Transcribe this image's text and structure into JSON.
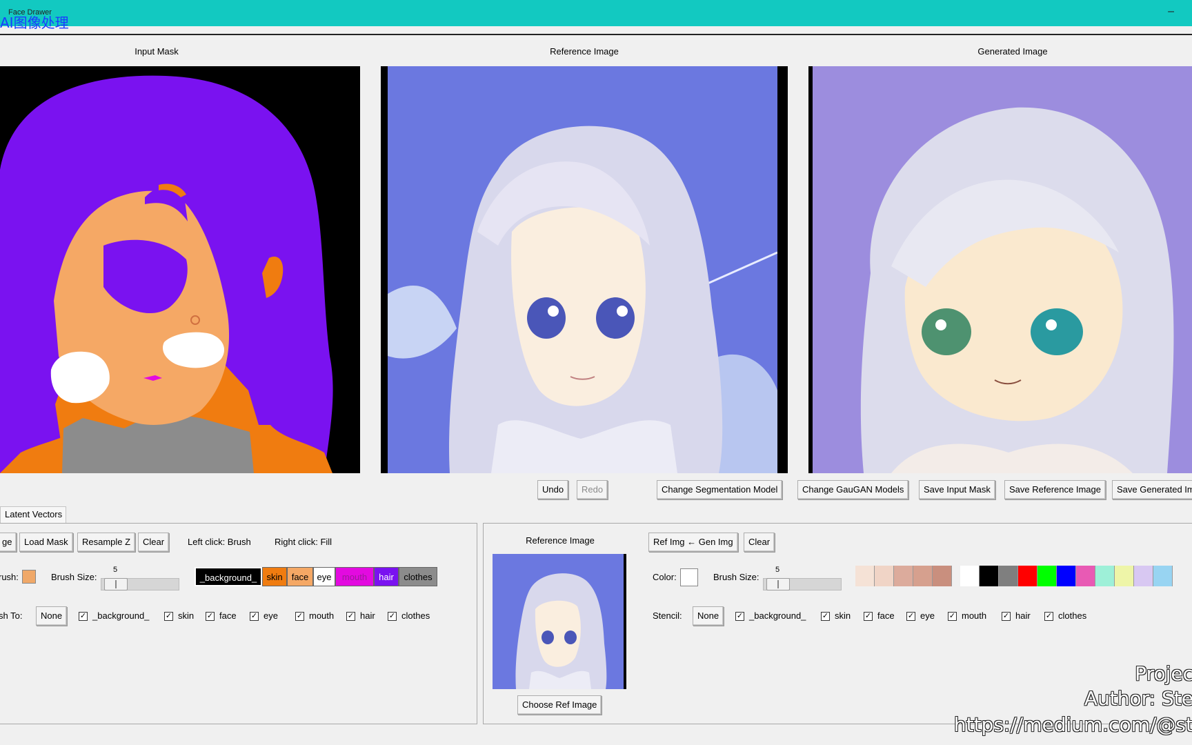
{
  "window": {
    "title": "Face Drawer",
    "overlay_title": "AI图像处理",
    "minimize_glyph": "–"
  },
  "panels": {
    "input_mask": {
      "title": "Input Mask"
    },
    "reference_image": {
      "title": "Reference Image"
    },
    "generated_image": {
      "title": "Generated Image"
    }
  },
  "toolbar": {
    "undo": "Undo",
    "redo": "Redo",
    "change_segmentation_model": "Change Segmentation Model",
    "change_gaugan_models": "Change GauGAN Models",
    "save_input_mask": "Save Input Mask",
    "save_reference_image": "Save Reference Image",
    "save_generated_image": "Save Generated Im"
  },
  "tabs": {
    "latent_vectors": "Latent Vectors"
  },
  "mask_controls": {
    "load_image": "ge",
    "load_mask": "Load Mask",
    "resample_z": "Resample Z",
    "clear": "Clear",
    "left_click_hint": "Left click: Brush",
    "right_click_hint": "Right click: Fill",
    "brush_label": "rush:",
    "brush_color": "#f0a868",
    "brush_size_label": "Brush Size:",
    "brush_size_value": "5",
    "brush_size_fraction": 0.05,
    "segments": [
      {
        "label": "_background_",
        "bg": "#000000",
        "fg": "#ffffff"
      },
      {
        "label": "skin",
        "bg": "#f07c10",
        "fg": "#000000"
      },
      {
        "label": "face",
        "bg": "#f5a865",
        "fg": "#000000"
      },
      {
        "label": "eye",
        "bg": "#ffffff",
        "fg": "#000000"
      },
      {
        "label": "mouth",
        "bg": "#e30ae0",
        "fg": "#9a1a9a"
      },
      {
        "label": "hair",
        "bg": "#7a12f0",
        "fg": "#ffffff"
      },
      {
        "label": "clothes",
        "bg": "#8c8c8c",
        "fg": "#000000"
      }
    ],
    "brush_to_label": "sh To:",
    "none_button": "None",
    "checkboxes": [
      "_background_",
      "skin",
      "face",
      "eye",
      "mouth",
      "hair",
      "clothes"
    ]
  },
  "ref_controls": {
    "title": "Reference Image",
    "choose_ref": "Choose Ref Image",
    "ref_from_gen": "Ref Img ← Gen Img",
    "clear": "Clear",
    "color_label": "Color:",
    "color_value": "#ffffff",
    "brush_size_label": "Brush Size:",
    "brush_size_value": "5",
    "brush_size_fraction": 0.05,
    "stencil_label": "Stencil:",
    "none_button": "None",
    "checkboxes": [
      "_background_",
      "skin",
      "face",
      "eye",
      "mouth",
      "hair",
      "clothes"
    ],
    "skin_palette": [
      "#f5e2d6",
      "#f0d4c6",
      "#dcab9c",
      "#d6a08e",
      "#c98f7e"
    ],
    "color_palette": [
      "#ffffff",
      "#000000",
      "#7f7f7f",
      "#ff0000",
      "#00ff00",
      "#0000ff",
      "#e85ab4",
      "#9ef0d8",
      "#eef5a8",
      "#d8c8f2",
      "#98d4f2"
    ]
  },
  "watermark": {
    "line1": "Projec",
    "line2": "Author: Ste",
    "line3": "https://medium.com/@st"
  }
}
